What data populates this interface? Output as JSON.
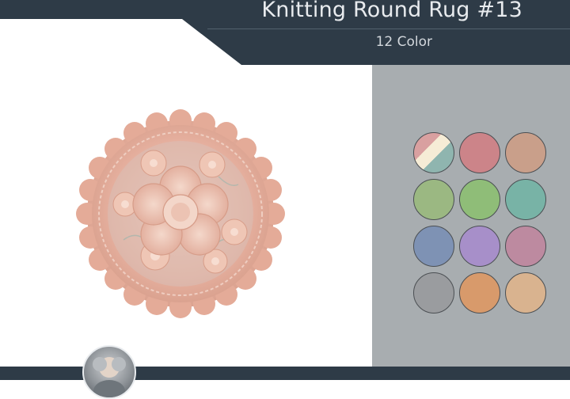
{
  "header": {
    "title": "Knitting Round Rug #13",
    "subtitle": "12 Color"
  },
  "swatches": [
    {
      "name": "multicolor",
      "color": "mixed"
    },
    {
      "name": "rose",
      "color": "#cc8489"
    },
    {
      "name": "peach",
      "color": "#c99f8a"
    },
    {
      "name": "sage",
      "color": "#9bb882"
    },
    {
      "name": "leaf-green",
      "color": "#8fbd78"
    },
    {
      "name": "teal",
      "color": "#78b3a6"
    },
    {
      "name": "slate-blue",
      "color": "#7e92b4"
    },
    {
      "name": "lavender",
      "color": "#a78fc9"
    },
    {
      "name": "mauve",
      "color": "#bd8aa0"
    },
    {
      "name": "grey",
      "color": "#9a9c9f"
    },
    {
      "name": "apricot",
      "color": "#d89a6b"
    },
    {
      "name": "sand",
      "color": "#d9b38f"
    }
  ],
  "colors": {
    "header": "#2e3b47",
    "panel": "#a8adb0",
    "rug": "#e8b4a4"
  },
  "icons": {
    "avatar": "creator-avatar-icon"
  }
}
